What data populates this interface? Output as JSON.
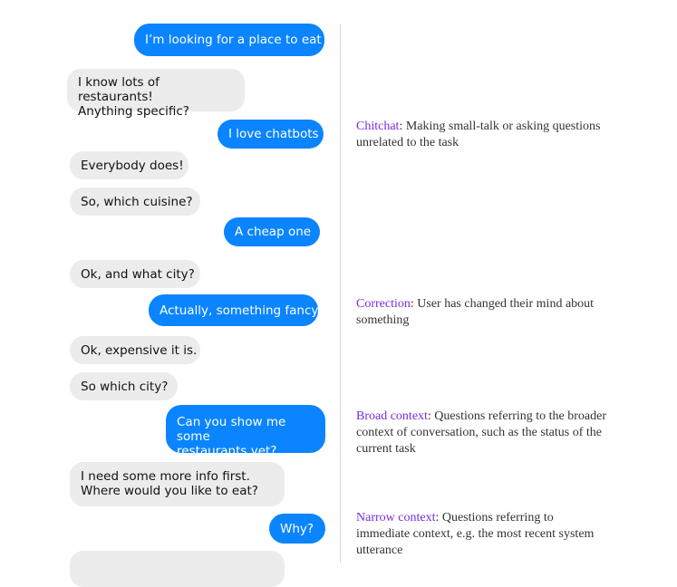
{
  "conversation": {
    "messages": [
      {
        "id": "m1",
        "sender": "user",
        "text": "I’m looking for a place to eat"
      },
      {
        "id": "m2",
        "sender": "bot",
        "text": "I know lots of restaurants!\nAnything specific?"
      },
      {
        "id": "m3",
        "sender": "user",
        "text": "I love chatbots"
      },
      {
        "id": "m4",
        "sender": "bot",
        "text": "Everybody does!"
      },
      {
        "id": "m5",
        "sender": "bot",
        "text": "So, which cuisine?"
      },
      {
        "id": "m6",
        "sender": "user",
        "text": "A cheap one"
      },
      {
        "id": "m7",
        "sender": "bot",
        "text": "Ok, and what city?"
      },
      {
        "id": "m8",
        "sender": "user",
        "text": "Actually, something fancy"
      },
      {
        "id": "m9",
        "sender": "bot",
        "text": "Ok, expensive it is."
      },
      {
        "id": "m10",
        "sender": "bot",
        "text": "So which city?"
      },
      {
        "id": "m11",
        "sender": "user",
        "text": "Can you show me some\nrestaurants yet?"
      },
      {
        "id": "m12",
        "sender": "bot",
        "text": "I need some more info first.\nWhere would you like to eat?"
      },
      {
        "id": "m13",
        "sender": "user",
        "text": "Why?"
      }
    ],
    "user_color": "#0a84ff",
    "bot_color": "#ececec"
  },
  "annotations": {
    "chitchat": {
      "term": "Chitchat",
      "description": ": Making small-talk or asking questions unrelated to the task"
    },
    "correction": {
      "term": "Correction",
      "description": ": User has changed their mind about something"
    },
    "broad_context": {
      "term": "Broad context",
      "description": ": Questions referring to the broader context of conversation, such as the status of the current task"
    },
    "narrow_context": {
      "term": "Narrow context",
      "description": ": Questions referring to immediate context, e.g. the most recent system utterance"
    },
    "term_color": "#7a2be0"
  }
}
